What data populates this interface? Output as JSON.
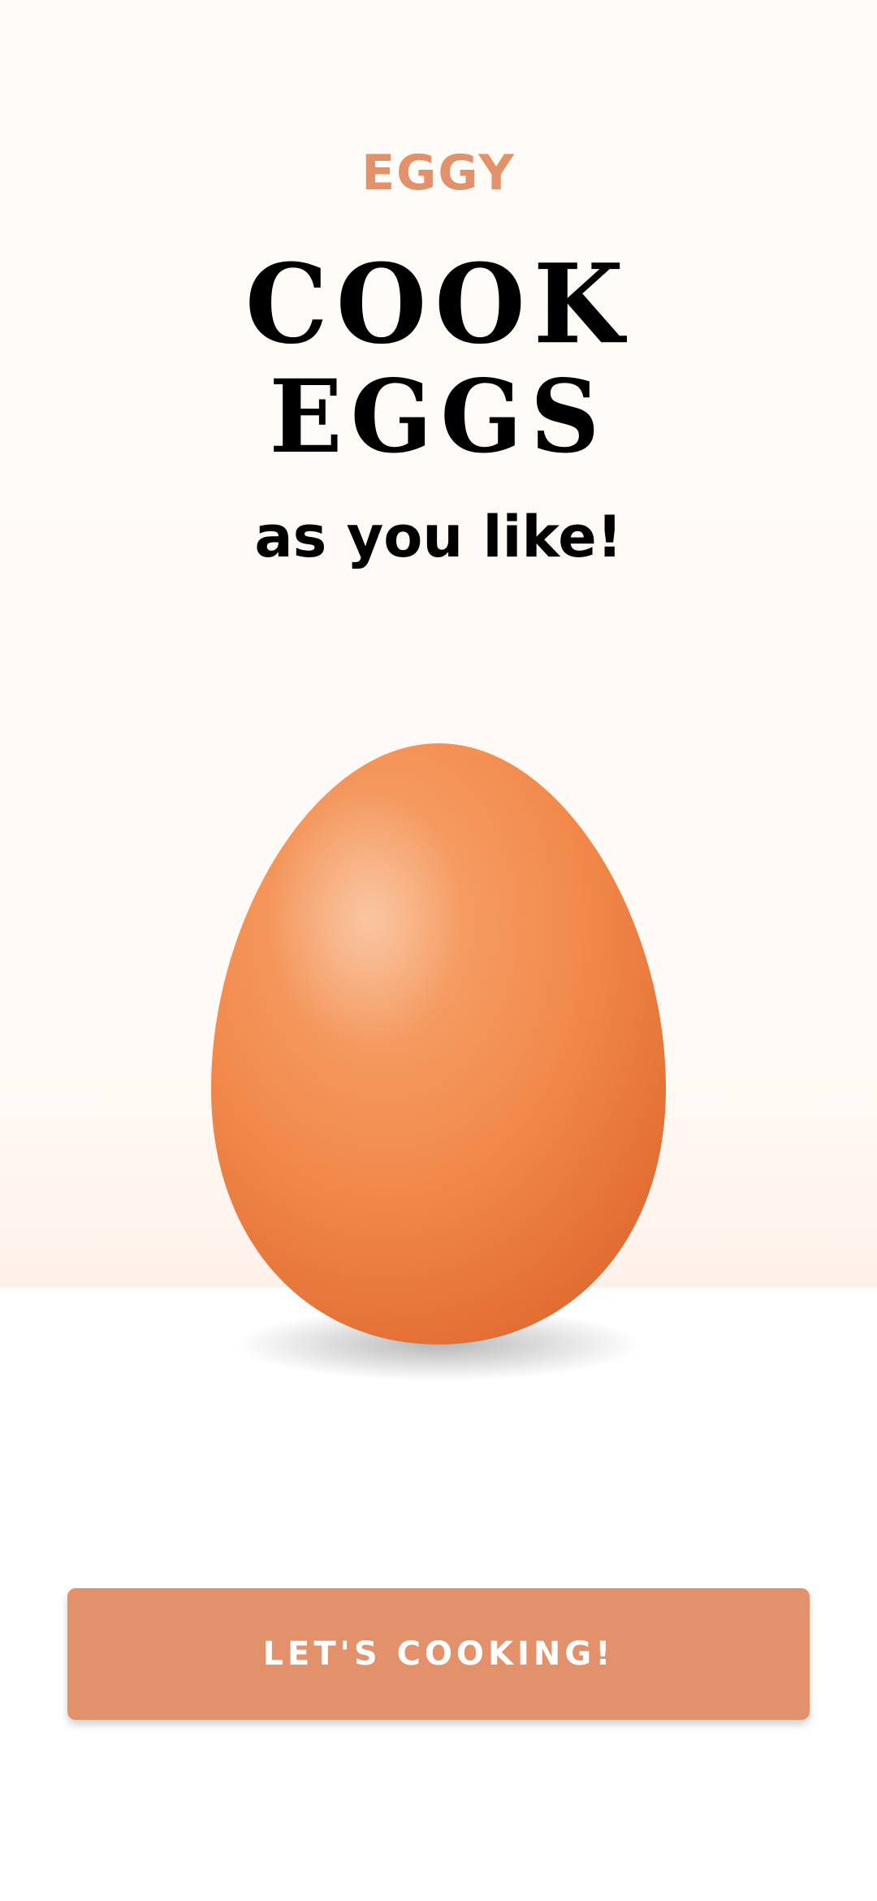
{
  "app": {
    "brand": "EGGY",
    "headline_line1": "Cook",
    "headline_line2": "Eggs",
    "tagline": "as you like!"
  },
  "hero": {
    "icon": "egg-icon"
  },
  "cta": {
    "label": "LET'S COOKING!"
  },
  "colors": {
    "accent": "#e3916a",
    "egg_light": "#f7a872",
    "egg_mid": "#f28a4c",
    "egg_dark": "#e06a30",
    "text": "#000000",
    "background_top": "#fffaf6"
  }
}
